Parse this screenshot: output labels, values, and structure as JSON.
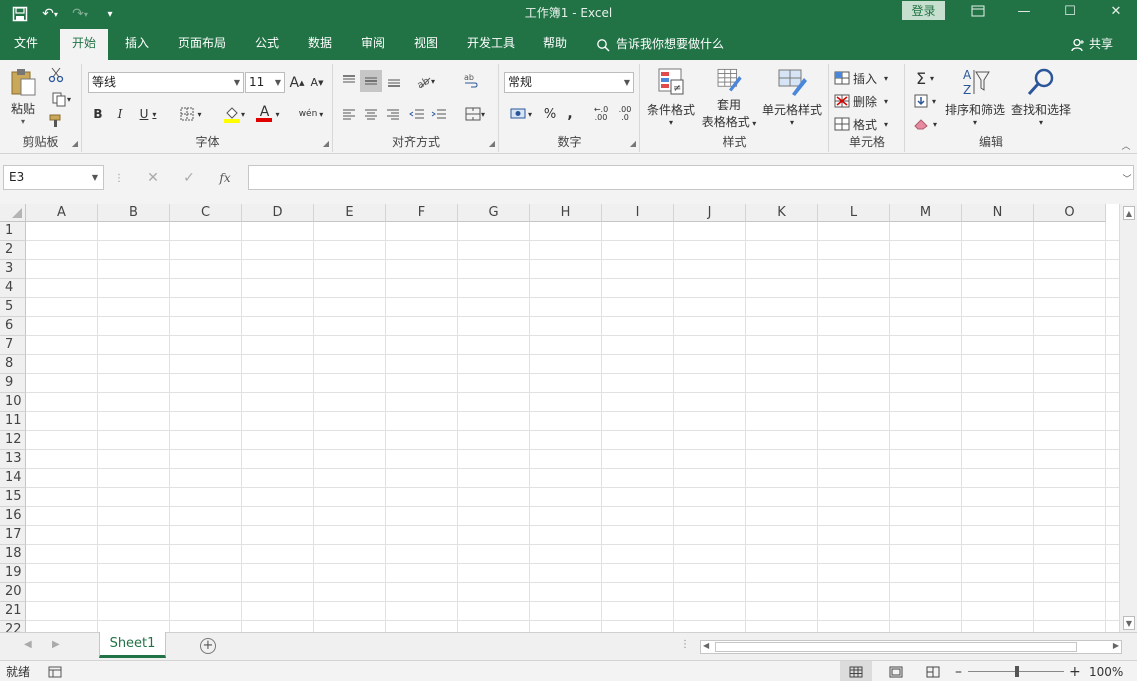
{
  "window": {
    "title": "工作簿1  -  Excel",
    "login_label": "登录"
  },
  "tabs": [
    {
      "label": "文件"
    },
    {
      "label": "开始"
    },
    {
      "label": "插入"
    },
    {
      "label": "页面布局"
    },
    {
      "label": "公式"
    },
    {
      "label": "数据"
    },
    {
      "label": "审阅"
    },
    {
      "label": "视图"
    },
    {
      "label": "开发工具"
    },
    {
      "label": "帮助"
    }
  ],
  "active_tab": "开始",
  "tellme": "告诉我你想要做什么",
  "share_label": "共享",
  "ribbon": {
    "clipboard": {
      "label": "剪贴板",
      "paste": "粘贴"
    },
    "font": {
      "label": "字体",
      "name": "等线",
      "size": "11",
      "bold": "B",
      "italic": "I",
      "underline": "U",
      "grow": "A",
      "shrink": "A",
      "color_a": "A",
      "phonetic": "wén"
    },
    "alignment": {
      "label": "对齐方式"
    },
    "number": {
      "label": "数字",
      "format": "常规",
      "percent": "%",
      "comma": ",",
      "inc_dec": ".00",
      "dec_dec": ".0"
    },
    "styles": {
      "label": "样式",
      "cond_format": "条件格式",
      "table_format_1": "套用",
      "table_format_2": "表格格式",
      "cell_style": "单元格样式"
    },
    "cells": {
      "label": "单元格",
      "insert": "插入",
      "delete": "删除",
      "format": "格式"
    },
    "editing": {
      "label": "编辑",
      "sort_filter": "排序和筛选",
      "find_select": "查找和选择"
    }
  },
  "formula_bar": {
    "name_box": "E3",
    "fx": "fx",
    "value": ""
  },
  "grid": {
    "columns": [
      "A",
      "B",
      "C",
      "D",
      "E",
      "F",
      "G",
      "H",
      "I",
      "J",
      "K",
      "L",
      "M",
      "N",
      "O"
    ],
    "rows": [
      "1",
      "2",
      "3",
      "4",
      "5",
      "6",
      "7",
      "8",
      "9",
      "10",
      "11",
      "12",
      "13",
      "14",
      "15",
      "16",
      "17",
      "18",
      "19",
      "20",
      "21",
      "22"
    ]
  },
  "sheets": [
    {
      "name": "Sheet1"
    }
  ],
  "status": {
    "ready": "就绪",
    "zoom": "100%"
  },
  "colors": {
    "brand": "#217346",
    "ribbon_bg": "#f3f3f3"
  }
}
